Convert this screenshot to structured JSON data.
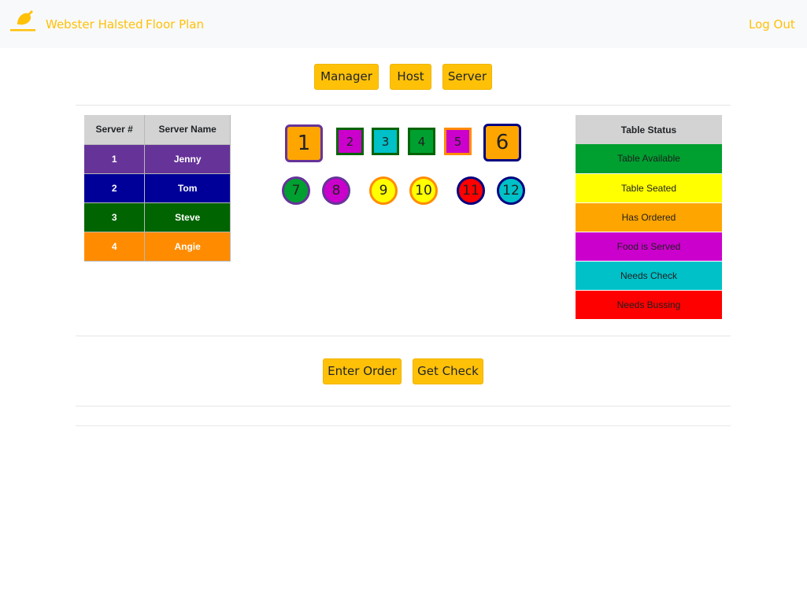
{
  "navbar": {
    "brand": "Webster Halsted",
    "floor_plan": "Floor Plan",
    "logout": "Log Out",
    "logo_icon": "fork-spoon-logo-icon",
    "accent_color": "#ffc107"
  },
  "role_buttons": {
    "manager": "Manager",
    "host": "Host",
    "server": "Server"
  },
  "servers_table": {
    "headers": [
      "Server #",
      "Server Name"
    ],
    "rows": [
      {
        "num": "1",
        "name": "Jenny",
        "color": "#663399"
      },
      {
        "num": "2",
        "name": "Tom",
        "color": "#000099"
      },
      {
        "num": "3",
        "name": "Steve",
        "color": "#006400"
      },
      {
        "num": "4",
        "name": "Angie",
        "color": "#ff8c00"
      }
    ]
  },
  "tables": [
    {
      "label": "1",
      "shape": "square",
      "fill": "#ffa500",
      "border": "#663399"
    },
    {
      "label": "2",
      "shape": "square",
      "fill": "#cc00cc",
      "border": "#006400"
    },
    {
      "label": "3",
      "shape": "square",
      "fill": "#00c0c8",
      "border": "#006400"
    },
    {
      "label": "4",
      "shape": "square",
      "fill": "#00a030",
      "border": "#006400"
    },
    {
      "label": "5",
      "shape": "square",
      "fill": "#cc00cc",
      "border": "#ff8c00"
    },
    {
      "label": "6",
      "shape": "square",
      "fill": "#ffa500",
      "border": "#000080"
    },
    {
      "label": "7",
      "shape": "circle",
      "fill": "#00a030",
      "border": "#663399"
    },
    {
      "label": "8",
      "shape": "circle",
      "fill": "#cc00cc",
      "border": "#663399"
    },
    {
      "label": "9",
      "shape": "circle",
      "fill": "#ffff00",
      "border": "#ff8c00"
    },
    {
      "label": "10",
      "shape": "circle",
      "fill": "#ffff00",
      "border": "#ff8c00"
    },
    {
      "label": "11",
      "shape": "circle",
      "fill": "#ff0000",
      "border": "#000080"
    },
    {
      "label": "12",
      "shape": "circle",
      "fill": "#00c0c8",
      "border": "#000080"
    }
  ],
  "status_table": {
    "header": "Table Status",
    "rows": [
      {
        "label": "Table Available",
        "color": "#00a030"
      },
      {
        "label": "Table Seated",
        "color": "#ffff00"
      },
      {
        "label": "Has Ordered",
        "color": "#ffa500"
      },
      {
        "label": "Food is Served",
        "color": "#cc00cc"
      },
      {
        "label": "Needs Check",
        "color": "#00c0c8"
      },
      {
        "label": "Needs Bussing",
        "color": "#ff0000"
      }
    ]
  },
  "action_buttons": {
    "enter_order": "Enter Order",
    "get_check": "Get Check"
  }
}
